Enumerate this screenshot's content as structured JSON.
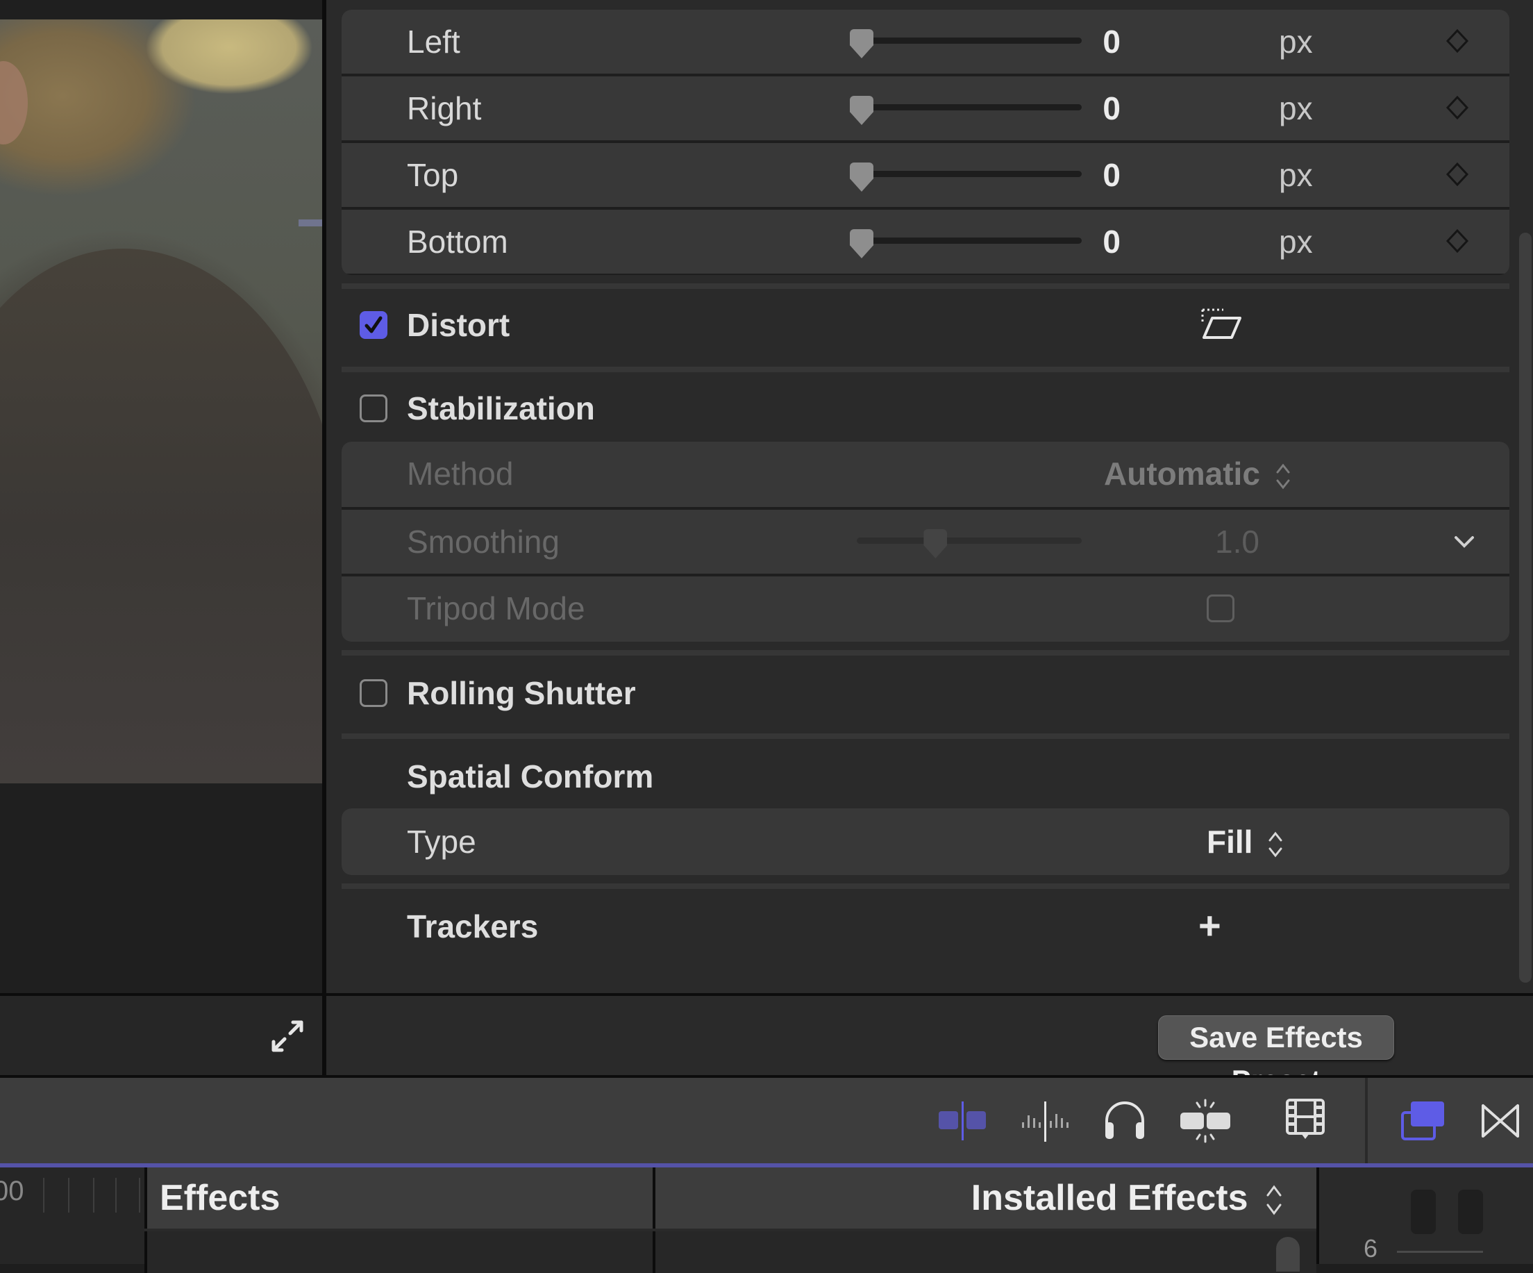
{
  "viewer": {
    "expand_icon": "expand-diagonal-arrows-icon"
  },
  "inspector": {
    "crop_rows": [
      {
        "label": "Left",
        "value": "0",
        "unit": "px",
        "slider_fraction": 0.0
      },
      {
        "label": "Right",
        "value": "0",
        "unit": "px",
        "slider_fraction": 0.0
      },
      {
        "label": "Top",
        "value": "0",
        "unit": "px",
        "slider_fraction": 0.0
      },
      {
        "label": "Bottom",
        "value": "0",
        "unit": "px",
        "slider_fraction": 0.0
      }
    ],
    "distort": {
      "label": "Distort",
      "checked": true,
      "icon": "distort-parallelogram-icon"
    },
    "stabilization": {
      "label": "Stabilization",
      "checked": false,
      "method": {
        "label": "Method",
        "value": "Automatic"
      },
      "smoothing": {
        "label": "Smoothing",
        "value": "1.0",
        "slider_fraction": 0.35
      },
      "tripod_mode": {
        "label": "Tripod Mode",
        "checked": false
      }
    },
    "rolling_shutter": {
      "label": "Rolling Shutter",
      "checked": false
    },
    "spatial_conform": {
      "label": "Spatial Conform",
      "type": {
        "label": "Type",
        "value": "Fill"
      }
    },
    "trackers": {
      "label": "Trackers",
      "add_symbol": "+"
    },
    "save_preset_label": "Save Effects Preset"
  },
  "toolbar": {
    "buttons": [
      {
        "name": "clip-skimming",
        "active": true
      },
      {
        "name": "audio-skimming",
        "active": false
      },
      {
        "name": "solo",
        "active": false
      },
      {
        "name": "snapping",
        "active": false
      },
      {
        "name": "clip-appearance",
        "active": false
      },
      {
        "name": "effects-browser",
        "active": true
      },
      {
        "name": "transitions-browser",
        "active": false
      }
    ]
  },
  "browser": {
    "ruler_text": "00",
    "effects_title": "Effects",
    "installed_effects_label": "Installed Effects",
    "meter_label": "6"
  },
  "colors": {
    "accent": "#5e5ce6",
    "accent_dim": "#5553a8",
    "panel_bg": "#2a2a2a",
    "row_bg": "#383838"
  }
}
